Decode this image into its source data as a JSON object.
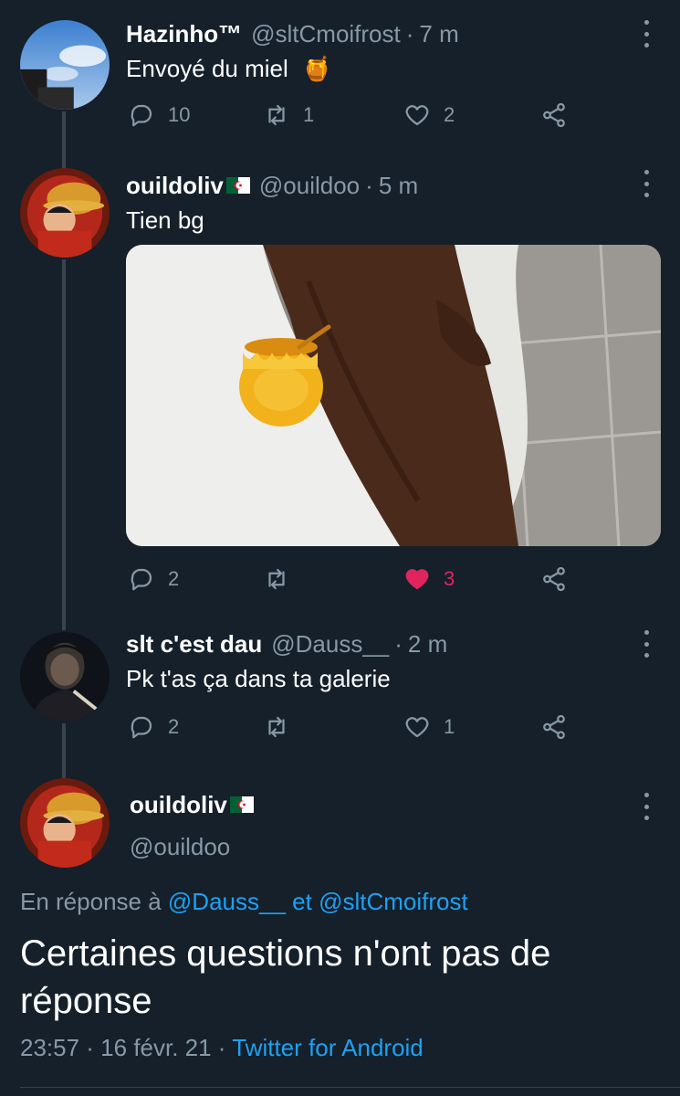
{
  "tweets": [
    {
      "name": "Hazinho™",
      "handle": "@sltCmoifrost",
      "time": "7 m",
      "text": "Envoyé du miel",
      "emoji": "🍯",
      "replies": "10",
      "retweets": "1",
      "likes": "2"
    },
    {
      "name": "ouildoliv",
      "handle": "@ouildoo",
      "time": "5 m",
      "text": "Tien bg",
      "replies": "2",
      "retweets": "",
      "likes": "3",
      "liked": true
    },
    {
      "name": "slt c'est dau",
      "handle": "@Dauss__",
      "time": "2 m",
      "text": "Pk t'as ça dans ta galerie",
      "replies": "2",
      "retweets": "",
      "likes": "1"
    }
  ],
  "main_tweet": {
    "name": "ouildoliv",
    "handle": "@ouildoo",
    "reply_prefix": "En réponse à",
    "reply_mention_1": "@Dauss__",
    "reply_and": "et",
    "reply_mention_2": "@sltCmoifrost",
    "text": "Certaines questions n'ont pas de réponse",
    "timestamp": "23:57 · 16 févr. 21 ·",
    "source": "Twitter for Android"
  },
  "colors": {
    "background": "#15202b",
    "secondary_text": "#8899a6",
    "link": "#1da1f2",
    "like": "#e0245e",
    "thread_line": "#38444d"
  }
}
